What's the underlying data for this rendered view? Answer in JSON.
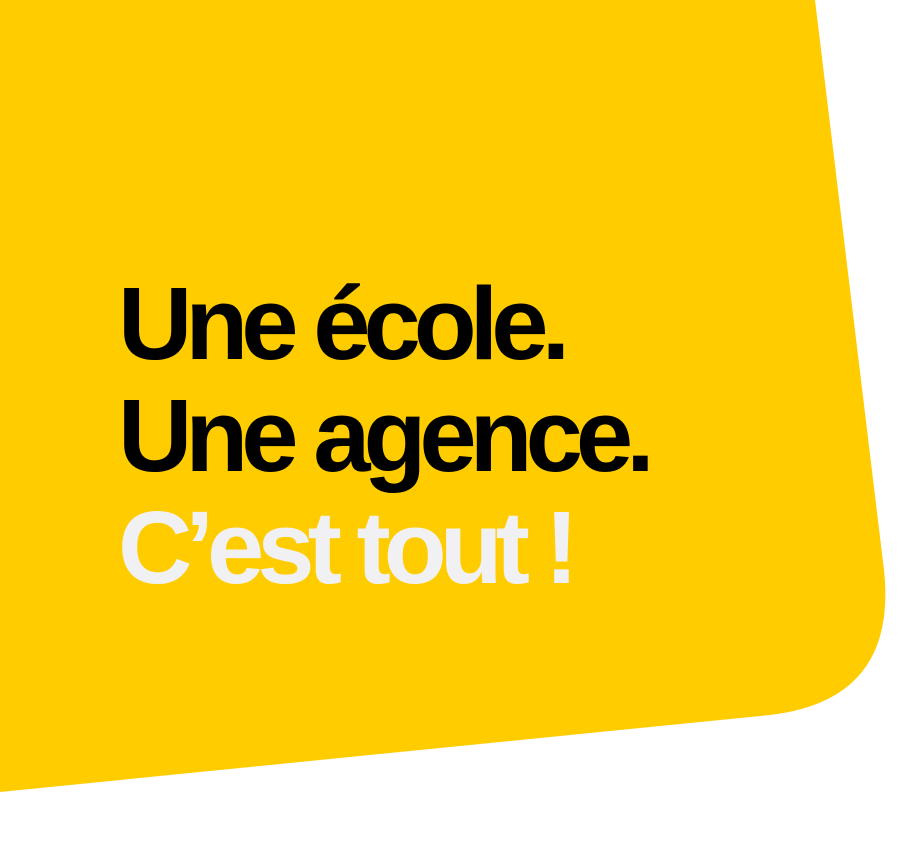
{
  "colors": {
    "accent": "#FFCC00",
    "text_dark": "#000000",
    "text_light": "#F1F1F4",
    "background": "#FFFFFF"
  },
  "headline": {
    "line1": "Une école.",
    "line2": "Une agence.",
    "line3": "C’est tout !"
  }
}
